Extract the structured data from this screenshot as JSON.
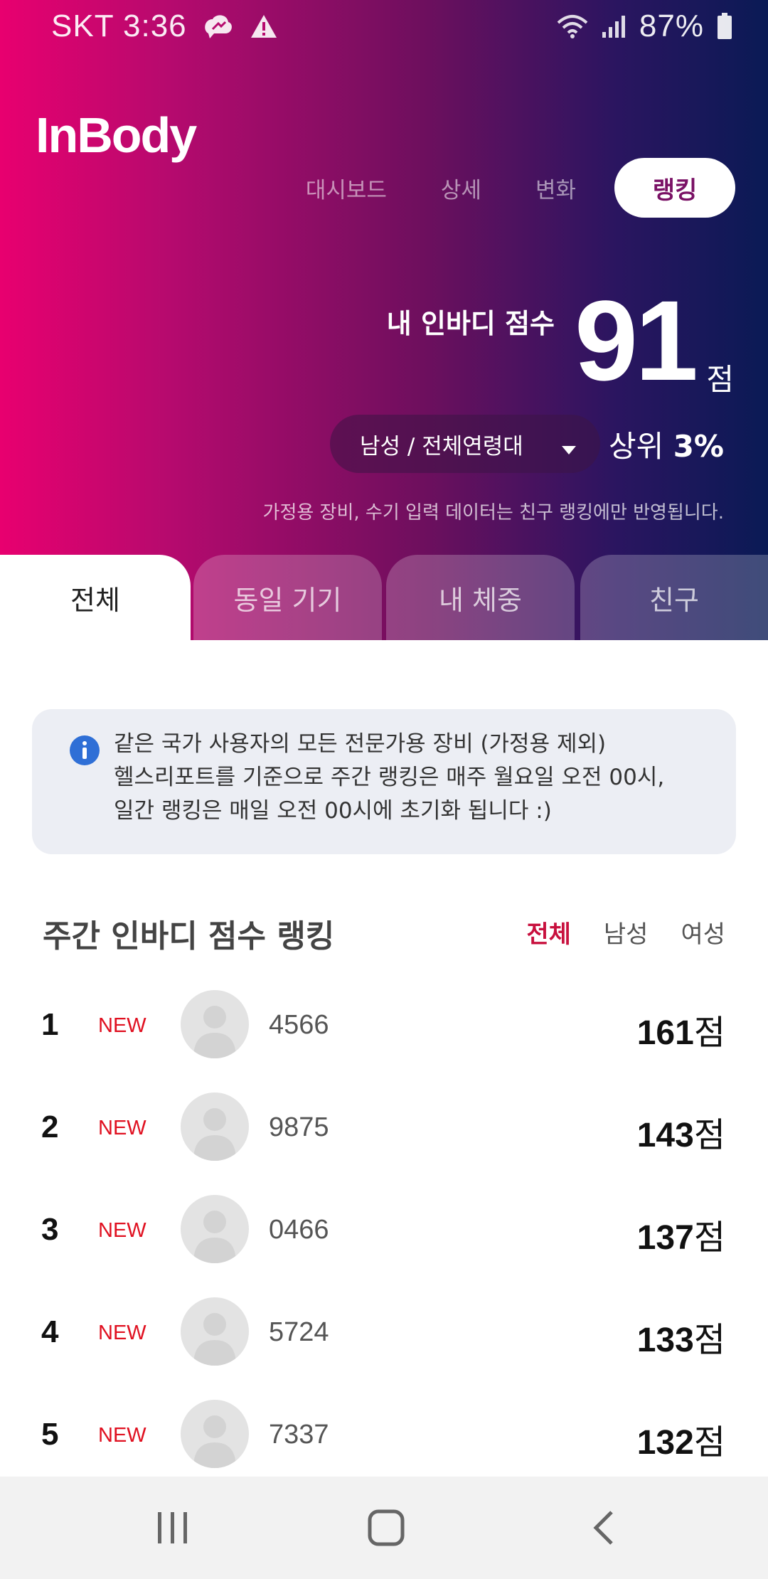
{
  "status_bar": {
    "carrier_time": "SKT 3:36",
    "battery": "87%",
    "icons": [
      "message-cloud-icon",
      "warning-icon",
      "wifi-icon",
      "signal-icon",
      "battery-icon"
    ]
  },
  "header": {
    "logo": "InBody",
    "tabs": [
      {
        "label": "대시보드",
        "active": false
      },
      {
        "label": "상세",
        "active": false
      },
      {
        "label": "변화",
        "active": false
      },
      {
        "label": "랭킹",
        "active": true
      }
    ],
    "score_label": "내 인바디 점수",
    "score": "91",
    "score_unit": "점",
    "group_select": "남성 / 전체연령대",
    "rank_prefix": "상위 ",
    "rank_value": "3%",
    "notice": "가정용 장비, 수기 입력 데이터는 친구 랭킹에만 반영됩니다."
  },
  "segment_tabs": [
    {
      "label": "전체",
      "active": true
    },
    {
      "label": "동일 기기",
      "active": false
    },
    {
      "label": "내 체중",
      "active": false
    },
    {
      "label": "친구",
      "active": false
    }
  ],
  "info": {
    "lines": [
      "같은 국가 사용자의 모든 전문가용 장비 (가정용 제외)",
      "헬스리포트를 기준으로 주간 랭킹은 매주 월요일 오전 00시,",
      "일간 랭킹은 매일 오전 00시에 초기화 됩니다 :)"
    ]
  },
  "ranking": {
    "title": "주간 인바디 점수 랭킹",
    "filters": [
      {
        "label": "전체",
        "active": true
      },
      {
        "label": "남성",
        "active": false
      },
      {
        "label": "여성",
        "active": false
      }
    ],
    "rows": [
      {
        "rank": "1",
        "badge": "NEW",
        "user": "4566",
        "score": "161",
        "unit": "점"
      },
      {
        "rank": "2",
        "badge": "NEW",
        "user": "9875",
        "score": "143",
        "unit": "점"
      },
      {
        "rank": "3",
        "badge": "NEW",
        "user": "0466",
        "score": "137",
        "unit": "점"
      },
      {
        "rank": "4",
        "badge": "NEW",
        "user": "5724",
        "score": "133",
        "unit": "점"
      },
      {
        "rank": "5",
        "badge": "NEW",
        "user": "7337",
        "score": "132",
        "unit": "점"
      }
    ]
  },
  "colors": {
    "gradient_start": "#e8006f",
    "gradient_end": "#0a1a55",
    "active_tab_text": "#7a1165",
    "filter_active": "#c8103e",
    "new_badge": "#e01020"
  }
}
